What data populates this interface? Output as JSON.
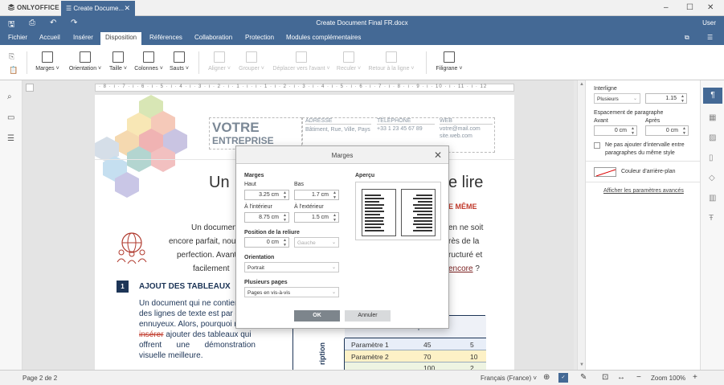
{
  "titlebar": {
    "app": "ONLYOFFICE",
    "doc_tab": "Create Docume...",
    "tab_close": "✕",
    "min": "‒",
    "max": "☐",
    "close": "✕"
  },
  "header": {
    "title": "Create Document Final FR.docx",
    "user": "User"
  },
  "menu": [
    "Fichier",
    "Accueil",
    "Insérer",
    "Disposition",
    "Références",
    "Collaboration",
    "Protection",
    "Modules complémentaires"
  ],
  "toolbar": {
    "margins": "Marges",
    "orientation": "Orientation",
    "size": "Taille",
    "columns": "Colonnes",
    "breaks": "Sauts",
    "align": "Aligner",
    "group": "Grouper",
    "forward": "Déplacer vers l'avant",
    "backward": "Reculer",
    "behind": "Retour à la ligne",
    "watermark": "Filigrane"
  },
  "doc": {
    "company1": "VOTRE",
    "company2": "ENTREPRISE",
    "addr_h": "ADRESSE",
    "addr_v": "Bâtiment, Rue, Ville, Pays",
    "tel_h": "TÉLÉPHONE",
    "tel_v": "+33 1 23 45 67 89",
    "web_h": "WEB",
    "web_v1": "votre@mail.com",
    "web_v2": "site.web.com",
    "title_left": "Un",
    "title_right": "e lire",
    "subtitle_right": "E MÊME",
    "p1": "Un document",
    "p1r": "en ne soit",
    "p2": "encore parfait, nou",
    "p2r": "rès de la",
    "p3": "perfection. Avant",
    "p3r": "ructuré et",
    "p4": "facilement",
    "p4r": "encore",
    "p4q": " ?",
    "num": "1",
    "section": "AJOUT DES TABLEAUX",
    "b1": "Un document qui ne contien",
    "b2": "des lignes de texte est par c",
    "b3": "ennuyeux. Alors, pourquoi n",
    "b4a": "insérer",
    "b4b": " ajouter des tableaux qui",
    "b5a": "offrent",
    "b5b": "une",
    "b5c": "démonstration",
    "b6": "visuelle meilleure.",
    "tbl_head": "Description",
    "tbl_side": "ription",
    "rows": [
      {
        "label": "Paramètre 1",
        "a": "45",
        "b": "5"
      },
      {
        "label": "Paramètre 2",
        "a": "70",
        "b": "10"
      },
      {
        "label": "",
        "a": "100",
        "b": "2"
      }
    ]
  },
  "panel": {
    "line_spacing": "Interligne",
    "ls_mode": "Plusieurs",
    "ls_val": "1.15",
    "para_spacing": "Espacement de paragraphe",
    "before": "Avant",
    "after": "Après",
    "before_val": "0 cm",
    "after_val": "0 cm",
    "no_space": "Ne pas ajouter d'intervalle entre paragraphes du même style",
    "bg_color": "Couleur d'arrière-plan",
    "advanced": "Afficher les paramètres avancés"
  },
  "status": {
    "page": "Page 2 de 2",
    "lang": "Français (France)",
    "zoom": "Zoom 100%"
  },
  "dialog": {
    "title": "Marges",
    "margins": "Marges",
    "top": "Haut",
    "top_val": "3.25 cm",
    "bottom": "Bas",
    "bottom_val": "1.7 cm",
    "inside": "À l'intérieur",
    "inside_val": "8.75 cm",
    "outside": "À l'extérieur",
    "outside_val": "1.5 cm",
    "gutter": "Position de la reliure",
    "gutter_val": "0 cm",
    "gutter_pos": "Gauche",
    "orientation": "Orientation",
    "orientation_val": "Portrait",
    "pages": "Plusieurs pages",
    "pages_val": "Pages en vis-à-vis",
    "preview": "Aperçu",
    "ok": "OK",
    "cancel": "Annuler"
  }
}
